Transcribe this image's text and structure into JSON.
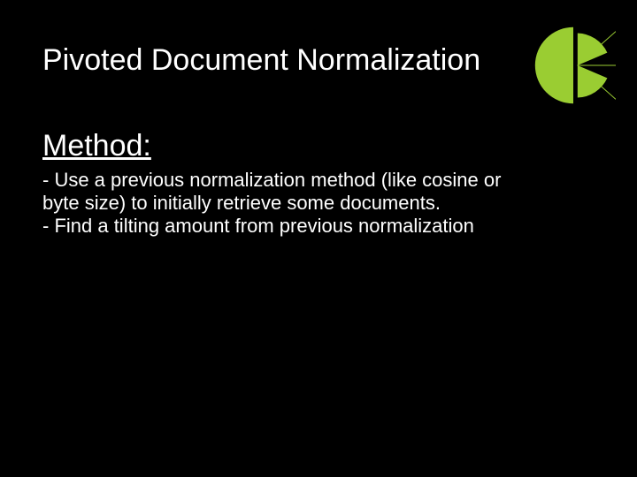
{
  "title": "Pivoted Document Normalization",
  "section_heading": "Method:",
  "body": "- Use a previous  normalization method (like cosine or byte size) to initially retrieve some documents.\n- Find a tilting amount from previous normalization",
  "colors": {
    "accent": "#9ACD32",
    "background": "#000000",
    "text": "#FFFFFF"
  }
}
